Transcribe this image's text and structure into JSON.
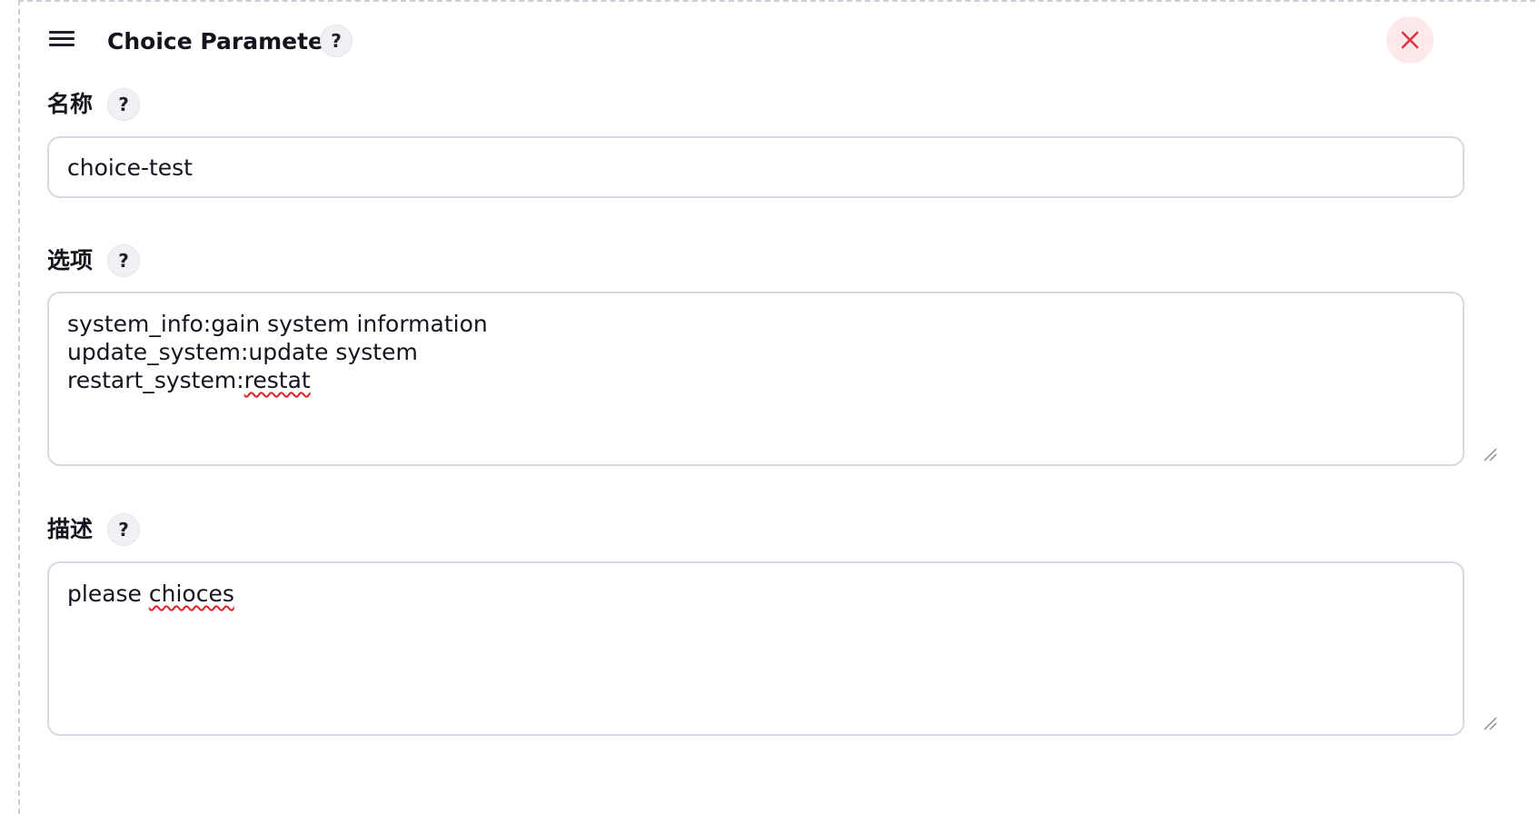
{
  "header": {
    "title": "Choice Parameter",
    "help": "?"
  },
  "fields": {
    "name": {
      "label": "名称",
      "help": "?",
      "value": "choice-test"
    },
    "choices": {
      "label": "选项",
      "help": "?",
      "lines": [
        "system_info:gain system information",
        "update_system:update system"
      ],
      "last_line_prefix": "restart_system:",
      "last_line_misspelled": "restat"
    },
    "description": {
      "label": "描述",
      "help": "?",
      "prefix": "please ",
      "misspelled": "chioces"
    }
  },
  "icons": {
    "drag": "hamburger-icon",
    "close": "close-icon",
    "close_color": "#e0303c"
  }
}
